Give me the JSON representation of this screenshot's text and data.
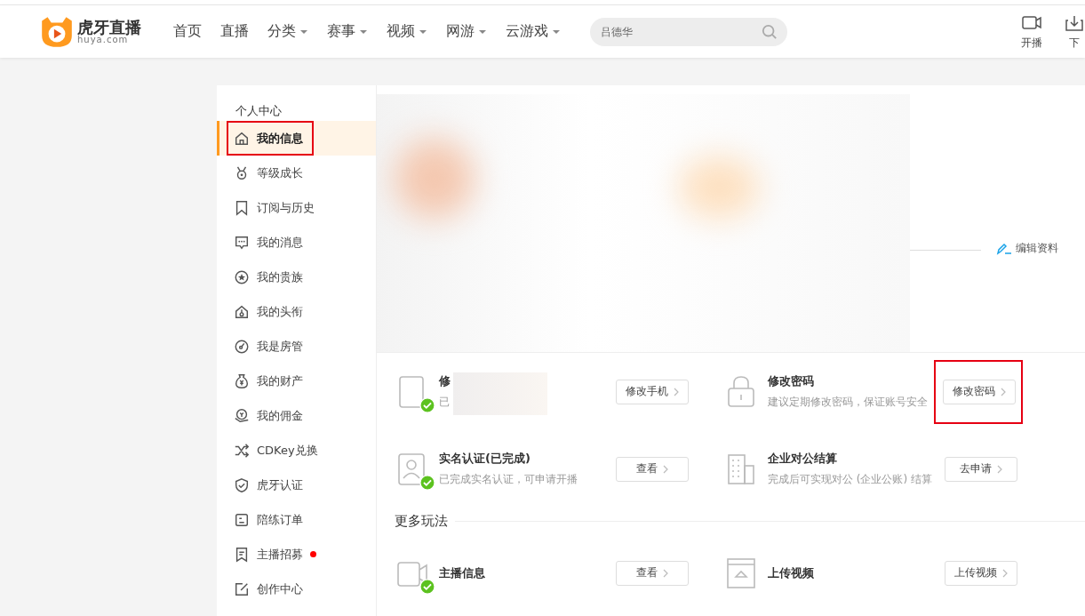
{
  "header": {
    "logo_text": "虎牙直播",
    "logo_sub": "huya.com",
    "nav": [
      {
        "label": "首页",
        "dropdown": false
      },
      {
        "label": "直播",
        "dropdown": false
      },
      {
        "label": "分类",
        "dropdown": true
      },
      {
        "label": "赛事",
        "dropdown": true
      },
      {
        "label": "视频",
        "dropdown": true
      },
      {
        "label": "网游",
        "dropdown": true
      },
      {
        "label": "云游戏",
        "dropdown": true
      }
    ],
    "search": {
      "placeholder": "吕德华"
    },
    "actions": [
      {
        "kind": "camera",
        "label": "开播"
      },
      {
        "kind": "download",
        "label": "下"
      }
    ]
  },
  "sidebar": {
    "title": "个人中心",
    "items": [
      {
        "kind": "home",
        "label": "我的信息",
        "selected": true,
        "highlighted": true,
        "dot": false
      },
      {
        "kind": "medal",
        "label": "等级成长",
        "selected": false,
        "highlighted": false,
        "dot": false
      },
      {
        "kind": "bookmark",
        "label": "订阅与历史",
        "selected": false,
        "highlighted": false,
        "dot": false
      },
      {
        "kind": "chat",
        "label": "我的消息",
        "selected": false,
        "highlighted": false,
        "dot": false
      },
      {
        "kind": "star",
        "label": "我的贵族",
        "selected": false,
        "highlighted": false,
        "dot": false
      },
      {
        "kind": "badge",
        "label": "我的头衔",
        "selected": false,
        "highlighted": false,
        "dot": false
      },
      {
        "kind": "gauge",
        "label": "我是房管",
        "selected": false,
        "highlighted": false,
        "dot": false
      },
      {
        "kind": "bag",
        "label": "我的财产",
        "selected": false,
        "highlighted": false,
        "dot": false
      },
      {
        "kind": "coin",
        "label": "我的佣金",
        "selected": false,
        "highlighted": false,
        "dot": false
      },
      {
        "kind": "shuffle",
        "label": "CDKey兑换",
        "selected": false,
        "highlighted": false,
        "dot": false
      },
      {
        "kind": "shield",
        "label": "虎牙认证",
        "selected": false,
        "highlighted": false,
        "dot": false
      },
      {
        "kind": "order",
        "label": "陪练订单",
        "selected": false,
        "highlighted": false,
        "dot": false
      },
      {
        "kind": "flag",
        "label": "主播招募",
        "selected": false,
        "highlighted": false,
        "dot": true
      },
      {
        "kind": "edit",
        "label": "创作中心",
        "selected": false,
        "highlighted": false,
        "dot": false
      }
    ]
  },
  "profile": {
    "edit_link": "编辑资料"
  },
  "security": [
    {
      "kind": "phone",
      "title": "修",
      "desc": "已",
      "verified": true,
      "blurred": true,
      "button": "修改手机",
      "highlighted": false
    },
    {
      "kind": "lock",
      "title": "修改密码",
      "desc": "建议定期修改密码，保证账号安全",
      "verified": false,
      "blurred": false,
      "button": "修改密码",
      "highlighted": true
    },
    {
      "kind": "person",
      "title": "实名认证(已完成)",
      "desc": "已完成实名认证，可申请开播",
      "verified": true,
      "blurred": false,
      "button": "查看",
      "highlighted": false
    },
    {
      "kind": "building",
      "title": "企业对公结算",
      "desc": "完成后可实现对公 (企业公账) 结算",
      "verified": false,
      "blurred": false,
      "button": "去申请",
      "highlighted": false
    }
  ],
  "more": {
    "title": "更多玩法",
    "items": [
      {
        "kind": "video",
        "title": "主播信息",
        "verified": true,
        "button": "查看",
        "highlighted": false
      },
      {
        "kind": "film",
        "title": "上传视频",
        "verified": false,
        "button": "上传视频",
        "highlighted": false
      }
    ]
  }
}
